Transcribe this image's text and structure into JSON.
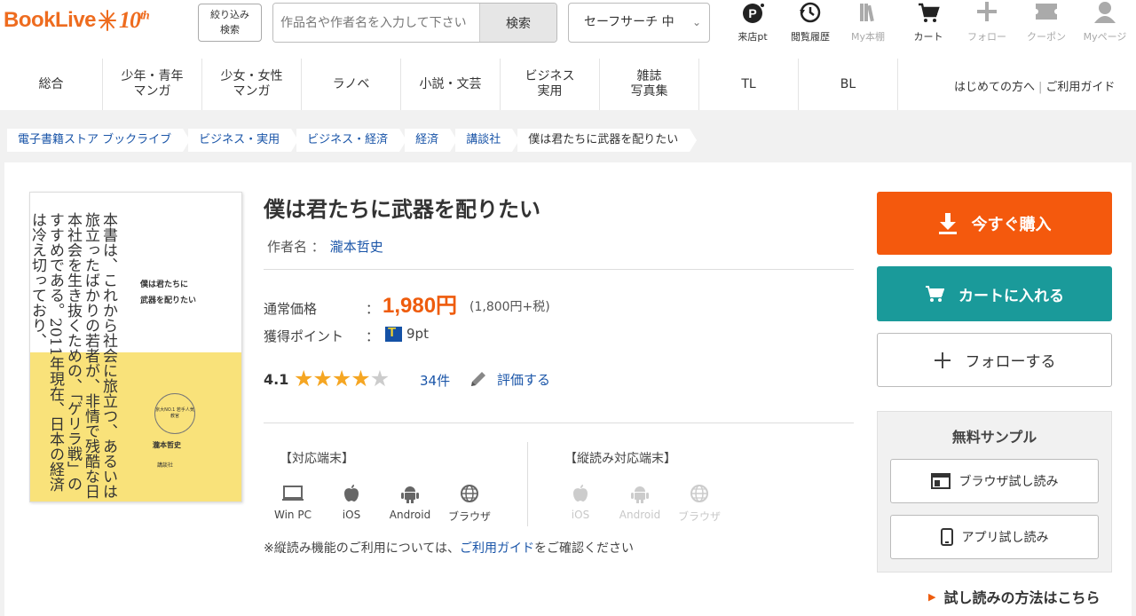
{
  "header": {
    "logo_text": "BookLive",
    "logo_anniv": "10",
    "logo_anniv_suffix": "th",
    "filter_line1": "絞り込み",
    "filter_line2": "検索",
    "search_placeholder": "作品名や作者名を入力して下さい",
    "search_button": "検索",
    "safe_search": "セーフサーチ 中",
    "icons": [
      {
        "label": "来店pt",
        "icon": "p-point-icon",
        "dim": false
      },
      {
        "label": "閲覧履歴",
        "icon": "history-icon",
        "dim": false
      },
      {
        "label": "My本棚",
        "icon": "bookshelf-icon",
        "dim": true
      },
      {
        "label": "カート",
        "icon": "cart-icon",
        "dim": false
      },
      {
        "label": "フォロー",
        "icon": "plus-icon",
        "dim": true
      },
      {
        "label": "クーポン",
        "icon": "coupon-icon",
        "dim": true
      },
      {
        "label": "Myページ",
        "icon": "user-icon",
        "dim": true
      }
    ]
  },
  "nav": {
    "categories": [
      "総合",
      "少年・青年\nマンガ",
      "少女・女性\nマンガ",
      "ラノベ",
      "小説・文芸",
      "ビジネス\n実用",
      "雑誌\n写真集",
      "TL",
      "BL"
    ],
    "beginner": "はじめての方へ",
    "guide": "ご利用ガイド"
  },
  "breadcrumbs": [
    "電子書籍ストア ブックライブ",
    "ビジネス・実用",
    "ビジネス・経済",
    "経済",
    "講談社",
    "僕は君たちに武器を配りたい"
  ],
  "cover": {
    "text": "本書は、これから社会に旅立つ、あるいは旅立ったばかりの若者が、非情で残酷な日本社会を生き抜くための、「ゲリラ戦」のすすめである。2011年現在、日本の経済は冷え切っており、",
    "title_line1": "僕は君たちに",
    "title_line2": "武器を配りたい",
    "badge": "京大NO.1 若手人気教官",
    "author": "瀧本哲史",
    "publisher": "講談社"
  },
  "book": {
    "title": "僕は君たちに武器を配りたい",
    "author_label": "作者名 ：",
    "author": "瀧本哲史",
    "price_label": "通常価格",
    "price_colon": "：",
    "price": "1,980円",
    "price_tax": "(1,800円+税)",
    "points_label": "獲得ポイント",
    "points_colon": "：",
    "points": "9pt",
    "rating": "4.1",
    "rating_value": 4.1,
    "stars_total": 5,
    "review_count": "34件",
    "rate_link": "評価する"
  },
  "devices": {
    "supported_title": "【対応端末】",
    "supported": [
      {
        "label": "Win PC",
        "icon": "pc-icon"
      },
      {
        "label": "iOS",
        "icon": "apple-icon"
      },
      {
        "label": "Android",
        "icon": "android-icon"
      },
      {
        "label": "ブラウザ",
        "icon": "browser-icon"
      }
    ],
    "vertical_title": "【縦読み対応端末】",
    "vertical": [
      {
        "label": "iOS",
        "icon": "apple-icon"
      },
      {
        "label": "Android",
        "icon": "android-icon"
      },
      {
        "label": "ブラウザ",
        "icon": "browser-icon"
      }
    ],
    "note_prefix": "※縦読み機能のご利用については、",
    "note_link": "ご利用ガイド",
    "note_suffix": "をご確認ください"
  },
  "actions": {
    "buy": "今すぐ購入",
    "cart": "カートに入れる",
    "follow": "フォローする",
    "sample_title": "無料サンプル",
    "browser_sample": "ブラウザ試し読み",
    "app_sample": "アプリ試し読み",
    "howto": "試し読みの方法はこちら"
  },
  "colors": {
    "brand_orange": "#ee6c1f",
    "buy_button": "#f4590d",
    "cart_button": "#1a9a9a",
    "link_blue": "#1a55a8",
    "price_orange": "#ee5c0d",
    "star": "#f5a623"
  }
}
